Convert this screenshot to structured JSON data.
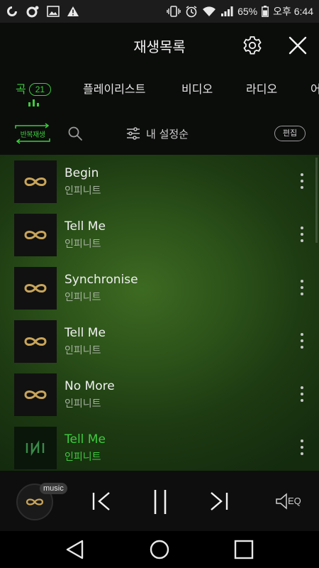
{
  "status_bar": {
    "battery": "65%",
    "time": "오후 6:44"
  },
  "header": {
    "title": "재생목록"
  },
  "tabs": [
    {
      "label": "곡",
      "badge": "21",
      "active": true
    },
    {
      "label": "플레이리스트"
    },
    {
      "label": "비디오"
    },
    {
      "label": "라디오"
    },
    {
      "label": "어"
    }
  ],
  "toolbar": {
    "repeat_label": "반복재생",
    "sort_label": "내 설정순",
    "edit_label": "편집"
  },
  "tracks": [
    {
      "title": "Begin",
      "artist": "인피니트"
    },
    {
      "title": "Tell Me",
      "artist": "인피니트"
    },
    {
      "title": "Synchronise",
      "artist": "인피니트"
    },
    {
      "title": "Tell Me",
      "artist": "인피니트"
    },
    {
      "title": "No More",
      "artist": "인피니트"
    },
    {
      "title": "Tell Me",
      "artist": "인피니트",
      "playing": true
    }
  ],
  "player": {
    "badge": "music",
    "eq_label": "EQ"
  },
  "colors": {
    "accent": "#3ecb3e",
    "gold": "#c9a55a"
  }
}
